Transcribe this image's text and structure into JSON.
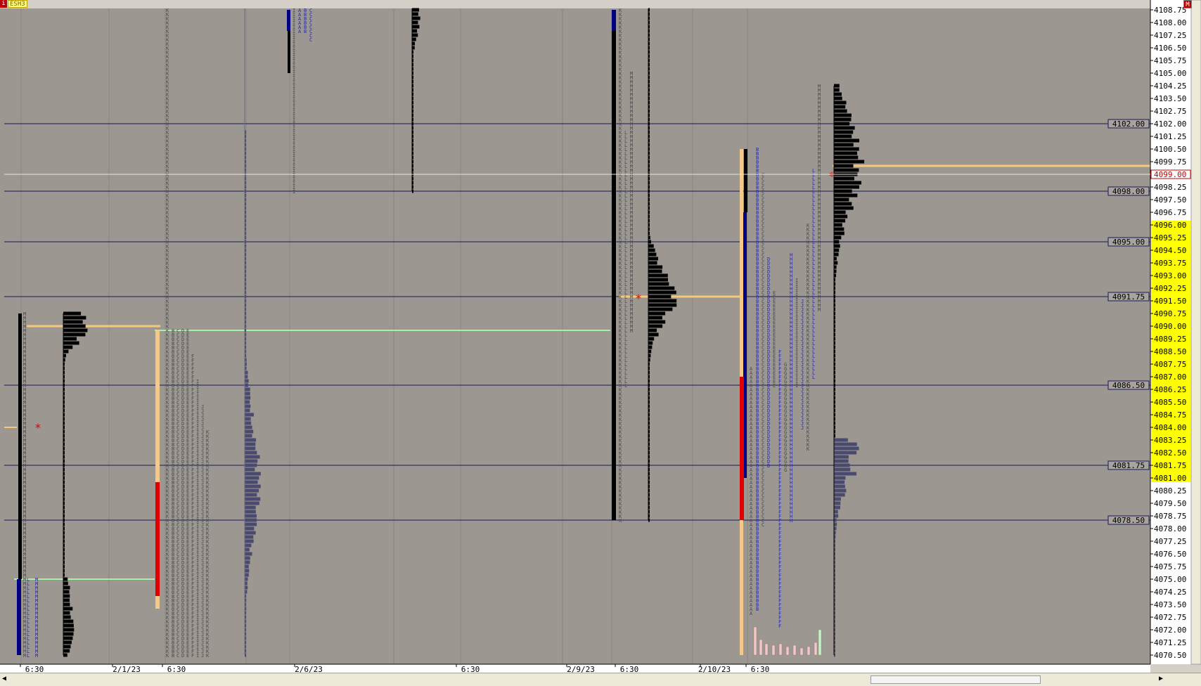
{
  "app": {
    "symbol": "ESH3",
    "left_icon": "i",
    "right_icon": "M"
  },
  "colors": {
    "background": "#9c9791",
    "axis_background": "#ffffff",
    "highlight_price_background": "#ffff00",
    "reference_line": "#1a1a5a",
    "poc_line": "#f5c97a",
    "single_print_line": "#a8f0a8",
    "tpo_text": "#4a4a4a",
    "tpo_blue": "#2a2aa0",
    "volume_black": "#000000",
    "volume_slate": "#4a4a6e",
    "ib_black": "#000000",
    "ib_navy": "#000080",
    "ib_red": "#e00000",
    "range_tan": "#f5c98a"
  },
  "chart_data": {
    "type": "market-profile",
    "y_axis": {
      "min": 4070.5,
      "max": 4108.75,
      "tick_step": 0.25,
      "labeled_step": 0.75,
      "labels": [
        "4108.75",
        "4108.00",
        "4107.25",
        "4106.50",
        "4105.75",
        "4105.00",
        "4104.25",
        "4103.50",
        "4102.75",
        "4102.00",
        "4101.25",
        "4100.50",
        "4099.75",
        "4099.00",
        "4098.25",
        "4097.50",
        "4096.75",
        "4096.00",
        "4095.25",
        "4094.50",
        "4093.75",
        "4093.00",
        "4092.25",
        "4091.50",
        "4090.75",
        "4090.00",
        "4089.25",
        "4088.50",
        "4087.75",
        "4087.00",
        "4086.25",
        "4085.50",
        "4084.75",
        "4084.00",
        "4083.25",
        "4082.50",
        "4081.75",
        "4081.00",
        "4080.25",
        "4079.50",
        "4078.75",
        "4078.00",
        "4077.25",
        "4076.50",
        "4075.75",
        "4075.00",
        "4074.25",
        "4073.50",
        "4072.75",
        "4072.00",
        "4071.25",
        "4070.50"
      ],
      "current_price": "4099.00",
      "highlighted_range": [
        4081.0,
        4096.0
      ]
    },
    "x_axis_labels": [
      "6:30",
      "2/1/23",
      "6:30",
      "2/6/23",
      "6:30",
      "2/9/23",
      "6:30",
      "2/10/23",
      "6:30"
    ],
    "reference_levels": [
      {
        "value": 4102.0,
        "label": "4102.00"
      },
      {
        "value": 4098.0,
        "label": "4098.00"
      },
      {
        "value": 4095.0,
        "label": "4095.00"
      },
      {
        "value": 4091.75,
        "label": "4091.75"
      },
      {
        "value": 4086.5,
        "label": "4086.50"
      },
      {
        "value": 4081.75,
        "label": "4081.75"
      },
      {
        "value": 4078.5,
        "label": "4078.50"
      }
    ],
    "poc_lines": [
      {
        "value": 4090.0,
        "from": "2/1",
        "to": "2/1"
      },
      {
        "value": 4091.75,
        "from": "2/9",
        "to": "2/10"
      },
      {
        "value": 4099.5,
        "from": "2/10",
        "to": "right-edge"
      }
    ],
    "single_print_lines": [
      {
        "value": 4089.75,
        "from": "2/1",
        "to": "2/9"
      },
      {
        "value": 4075.0,
        "from": "1/31",
        "to": "2/1"
      }
    ],
    "sessions": [
      {
        "id": "1/31",
        "high": 4090.75,
        "low": 4070.5,
        "poc": 4090.0,
        "ib_color": "black",
        "letters": "M"
      },
      {
        "id": "2/1",
        "high": 4108.75,
        "low": 4070.5,
        "poc": 4075.0,
        "ib_color": "red",
        "letters": "ABCDEFIJK"
      },
      {
        "id": "2/6",
        "high": 4108.75,
        "low": 4098.0,
        "poc": 4104.0,
        "ib_color": "black",
        "letters": "ABCI"
      },
      {
        "id": "2/9",
        "high": 4108.75,
        "low": 4078.5,
        "poc": 4091.75,
        "ib_color": "black",
        "letters": "KLM"
      },
      {
        "id": "2/10",
        "high": 4100.5,
        "low": 4070.5,
        "poc": 4099.5,
        "ib_color": "red",
        "letters": "ABCDEFGHIJKLMNO"
      }
    ]
  }
}
